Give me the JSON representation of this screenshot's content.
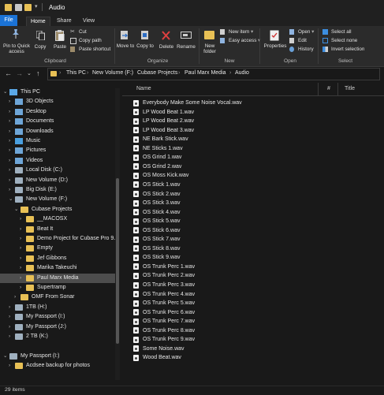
{
  "window": {
    "title": "Audio"
  },
  "ribbon_tabs": [
    "File",
    "Home",
    "Share",
    "View"
  ],
  "ribbon": {
    "clipboard": {
      "pin": "Pin to Quick access",
      "copy": "Copy",
      "paste": "Paste",
      "cut": "Cut",
      "copy_path": "Copy path",
      "paste_shortcut": "Paste shortcut",
      "group": "Clipboard"
    },
    "organize": {
      "move_to": "Move to",
      "copy_to": "Copy to",
      "delete": "Delete",
      "rename": "Rename",
      "group": "Organize"
    },
    "new": {
      "new_folder": "New folder",
      "new_item": "New item",
      "easy_access": "Easy access",
      "group": "New"
    },
    "open": {
      "properties": "Properties",
      "open": "Open",
      "edit": "Edit",
      "history": "History",
      "group": "Open"
    },
    "select": {
      "select_all": "Select all",
      "select_none": "Select none",
      "invert_selection": "Invert selection",
      "group": "Select"
    }
  },
  "address": {
    "crumbs": [
      "This PC",
      "New Volume (F:)",
      "Cubase Projects",
      "Paul Marx Media",
      "Audio"
    ]
  },
  "nav_tree": [
    {
      "label": "This PC",
      "icon": "pc-icon",
      "chev": "v",
      "indent": 0
    },
    {
      "label": "3D Objects",
      "icon": "3d-objects-icon",
      "chev": ">",
      "indent": 1
    },
    {
      "label": "Desktop",
      "icon": "desktop-icon",
      "chev": ">",
      "indent": 1
    },
    {
      "label": "Documents",
      "icon": "documents-icon",
      "chev": ">",
      "indent": 1
    },
    {
      "label": "Downloads",
      "icon": "downloads-icon",
      "chev": ">",
      "indent": 1
    },
    {
      "label": "Music",
      "icon": "music-icon",
      "chev": ">",
      "indent": 1
    },
    {
      "label": "Pictures",
      "icon": "pictures-icon",
      "chev": ">",
      "indent": 1
    },
    {
      "label": "Videos",
      "icon": "videos-icon",
      "chev": ">",
      "indent": 1
    },
    {
      "label": "Local Disk (C:)",
      "icon": "drive-icon",
      "chev": ">",
      "indent": 1
    },
    {
      "label": "New Volume (D:)",
      "icon": "drive-icon",
      "chev": ">",
      "indent": 1
    },
    {
      "label": "Big Disk (E:)",
      "icon": "drive-icon",
      "chev": ">",
      "indent": 1
    },
    {
      "label": "New Volume (F:)",
      "icon": "drive-icon",
      "chev": "v",
      "indent": 1
    },
    {
      "label": "Cubase Projects",
      "icon": "folder-icon",
      "chev": "v",
      "indent": 2
    },
    {
      "label": "__MACOSX",
      "icon": "folder-icon",
      "chev": ">",
      "indent": 3
    },
    {
      "label": "Beat It",
      "icon": "folder-icon",
      "chev": ">",
      "indent": 3
    },
    {
      "label": "Demo Project for Cubase Pro 9.5",
      "icon": "folder-icon",
      "chev": ">",
      "indent": 3
    },
    {
      "label": "Empty",
      "icon": "folder-icon",
      "chev": ">",
      "indent": 3
    },
    {
      "label": "Jef Gibbons",
      "icon": "folder-icon",
      "chev": ">",
      "indent": 3
    },
    {
      "label": "Marika Takeuchi",
      "icon": "folder-icon",
      "chev": ">",
      "indent": 3
    },
    {
      "label": "Paul Marx Media",
      "icon": "folder-icon",
      "chev": ">",
      "indent": 3,
      "selected": true
    },
    {
      "label": "Supertramp",
      "icon": "folder-icon",
      "chev": ">",
      "indent": 3
    },
    {
      "label": "OMF From Sonar",
      "icon": "folder-icon",
      "chev": ">",
      "indent": 2
    },
    {
      "label": "1TB (H:)",
      "icon": "drive-icon",
      "chev": ">",
      "indent": 1
    },
    {
      "label": "My Passport (I:)",
      "icon": "drive-icon",
      "chev": ">",
      "indent": 1
    },
    {
      "label": "My Passport (J:)",
      "icon": "drive-icon",
      "chev": ">",
      "indent": 1
    },
    {
      "label": "2 TB (K:)",
      "icon": "drive-icon",
      "chev": ">",
      "indent": 1
    },
    {
      "label": "",
      "icon": "",
      "chev": "",
      "indent": 0
    },
    {
      "label": "My Passport (I:)",
      "icon": "drive-icon",
      "chev": "v",
      "indent": 0
    },
    {
      "label": "Acdsee backup for photos",
      "icon": "folder-icon",
      "chev": ">",
      "indent": 1
    }
  ],
  "columns": {
    "name": "Name",
    "number": "#",
    "title": "Title"
  },
  "files": [
    "Everybody Make Some Noise Vocal.wav",
    "LP Wood Beat 1.wav",
    "LP Wood Beat 2.wav",
    "LP Wood Beat 3.wav",
    "NE Bark Stick.wav",
    "NE Sticks 1.wav",
    "OS Grind 1.wav",
    "OS Grind 2.wav",
    "OS Moss Kick.wav",
    "OS Stick 1.wav",
    "OS Stick 2.wav",
    "OS Stick 3.wav",
    "OS Stick 4.wav",
    "OS Stick 5.wav",
    "OS Stick 6.wav",
    "OS Stick 7.wav",
    "OS Stick 8.wav",
    "OS Stick 9.wav",
    "OS Trunk Perc 1.wav",
    "OS Trunk Perc 2.wav",
    "OS Trunk Perc 3.wav",
    "OS Trunk Perc 4.wav",
    "OS Trunk Perc 5.wav",
    "OS Trunk Perc 6.wav",
    "OS Trunk Perc 7.wav",
    "OS Trunk Perc 8.wav",
    "OS Trunk Perc 9.wav",
    "Some Noise.wav",
    "Wood Beat.wav"
  ],
  "status": {
    "items": "29 items"
  },
  "colors": {
    "accent": "#1b73d6",
    "folder": "#e8c055",
    "selected": "#4d4d4d"
  }
}
